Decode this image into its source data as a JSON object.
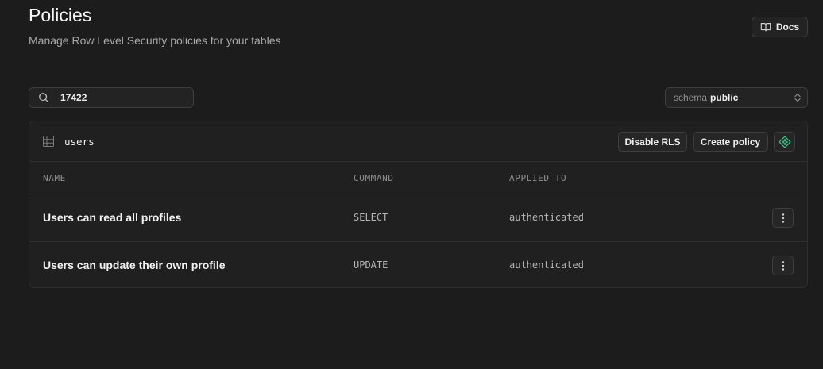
{
  "header": {
    "title": "Policies",
    "subtitle": "Manage Row Level Security policies for your tables",
    "docs_label": "Docs"
  },
  "search": {
    "value": "17422",
    "icon": "search-icon"
  },
  "schema_selector": {
    "label": "schema",
    "value": "public"
  },
  "table_panel": {
    "table_name": "users",
    "disable_rls_label": "Disable RLS",
    "create_policy_label": "Create policy",
    "columns": {
      "name": "NAME",
      "command": "COMMAND",
      "applied_to": "APPLIED TO"
    },
    "policies": [
      {
        "name": "Users can read all profiles",
        "command": "SELECT",
        "applied_to": "authenticated"
      },
      {
        "name": "Users can update their own profile",
        "command": "UPDATE",
        "applied_to": "authenticated"
      }
    ]
  },
  "colors": {
    "background": "#1c1c1c",
    "panel": "#202020",
    "accent": "#3ecf8e"
  }
}
